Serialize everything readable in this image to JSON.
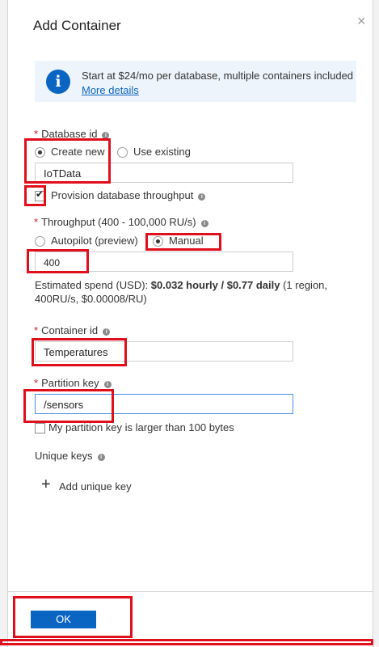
{
  "title": "Add Container",
  "close_icon": "close-icon",
  "info": {
    "text": "Start at $24/mo per database, multiple containers included",
    "link": "More details",
    "icon": "info-icon",
    "icon_glyph": "i"
  },
  "database_id": {
    "label": "Database id",
    "options": [
      "Create new",
      "Use existing"
    ],
    "selected": "Create new",
    "value": "IoTData",
    "provision_label": "Provision database throughput",
    "provision_checked": true
  },
  "throughput": {
    "label": "Throughput (400 - 100,000 RU/s)",
    "options": [
      "Autopilot (preview)",
      "Manual"
    ],
    "selected": "Manual",
    "value": "400",
    "spend_prefix": "Estimated spend (USD): ",
    "spend_bold": "$0.032 hourly / $0.77 daily",
    "spend_suffix": " (1 region,",
    "spend_line2": "400RU/s, $0.00008/RU)"
  },
  "container_id": {
    "label": "Container id",
    "value": "Temperatures"
  },
  "partition_key": {
    "label": "Partition key",
    "value": "/sensors",
    "large_label": "My partition key is larger than 100 bytes",
    "large_checked": false
  },
  "unique_keys": {
    "label": "Unique keys",
    "add_label": "Add unique key",
    "plus_glyph": "+"
  },
  "footer": {
    "ok_label": "OK"
  },
  "required_mark": "*",
  "tooltip_glyph": "i",
  "check_glyph": "✔",
  "close_glyph": "×",
  "colors": {
    "accent": "#0a64c2",
    "highlight": "#e10e1c",
    "required": "#d01d1d"
  }
}
